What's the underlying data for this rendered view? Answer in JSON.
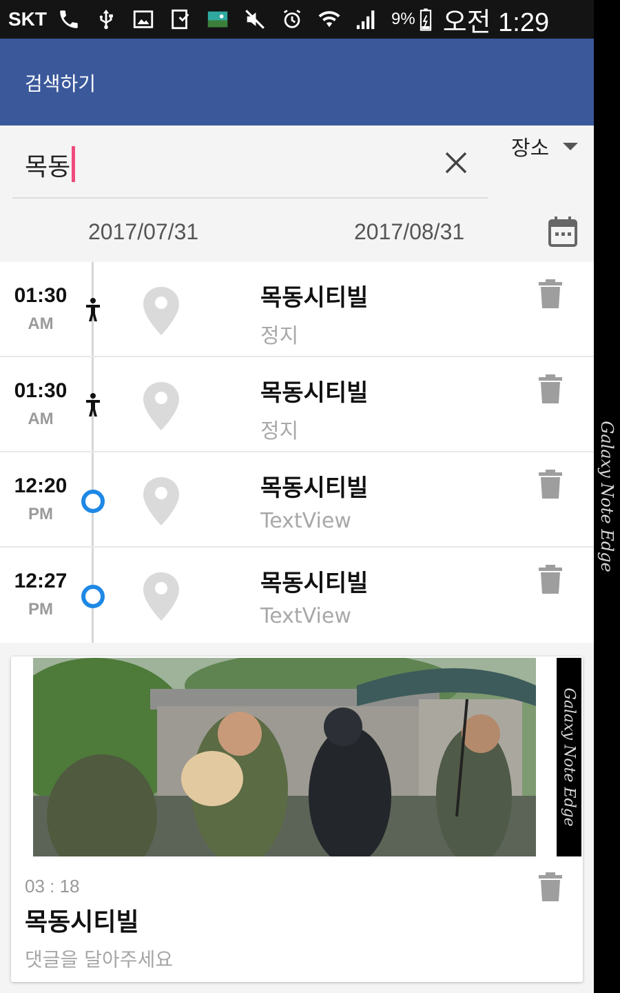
{
  "status_bar": {
    "carrier": "SKT",
    "battery": "9%",
    "clock": "오전 1:29",
    "icons": [
      "call-icon",
      "usb-icon",
      "image-icon",
      "download-icon",
      "gallery-icon",
      "mute-icon",
      "alarm-icon",
      "wifi-icon",
      "signal-icon",
      "battery-icon"
    ]
  },
  "app_bar": {
    "title": "검색하기",
    "background": "#3b589b"
  },
  "search": {
    "value": "목동",
    "cursor_color": "#f04a7e"
  },
  "filter": {
    "selected": "장소"
  },
  "date_range": {
    "start": "2017/07/31",
    "end": "2017/08/31"
  },
  "timeline": {
    "items": [
      {
        "time": "01:30",
        "ampm": "AM",
        "marker": "person-icon",
        "title": "목동시티빌",
        "subtitle": "정지"
      },
      {
        "time": "01:30",
        "ampm": "AM",
        "marker": "person-icon",
        "title": "목동시티빌",
        "subtitle": "정지"
      },
      {
        "time": "12:20",
        "ampm": "PM",
        "marker": "circle-marker-icon",
        "title": "목동시티빌",
        "subtitle": "TextView"
      },
      {
        "time": "12:27",
        "ampm": "PM",
        "marker": "circle-marker-icon",
        "title": "목동시티빌",
        "subtitle": "TextView"
      }
    ],
    "marker_color": "#1e88e5"
  },
  "card": {
    "time": "03 : 18",
    "title": "목동시티빌",
    "comment": "댓글을 달아주세요",
    "photo_edge_text": "Galaxy Note Edge"
  },
  "edge_text": "Galaxy Note Edge"
}
